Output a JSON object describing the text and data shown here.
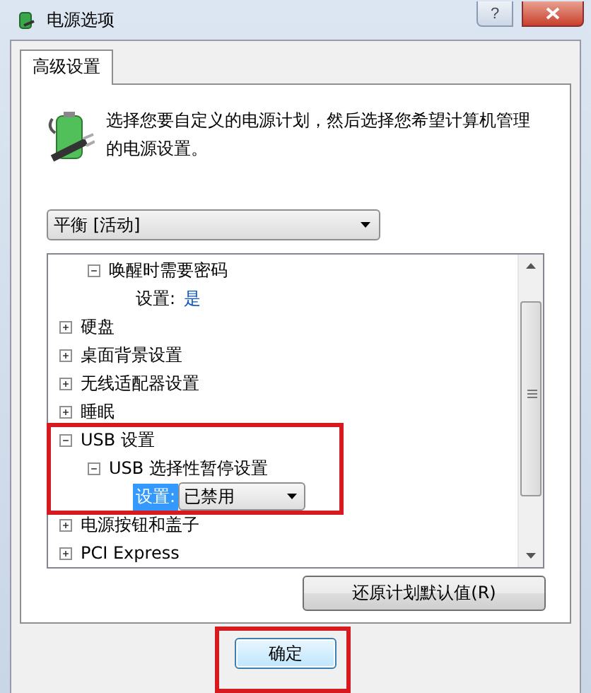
{
  "window": {
    "title": "电源选项",
    "help": "?"
  },
  "tabs": [
    {
      "label": "高级设置",
      "selected": true
    }
  ],
  "description": "选择您要自定义的电源计划，然后选择您希望计算机管理的电源设置。",
  "plan_dropdown": {
    "value": "平衡 [活动]"
  },
  "tree": {
    "items": [
      {
        "kind": "hidden-parent",
        "children": [
          {
            "kind": "group",
            "label": "唤醒时需要密码",
            "expanded": true,
            "children": [
              {
                "kind": "setting",
                "label": "设置:",
                "value": "是",
                "selected": false
              }
            ]
          }
        ]
      },
      {
        "kind": "group",
        "label": "硬盘",
        "expanded": false
      },
      {
        "kind": "group",
        "label": "桌面背景设置",
        "expanded": false
      },
      {
        "kind": "group",
        "label": "无线适配器设置",
        "expanded": false
      },
      {
        "kind": "group",
        "label": "睡眠",
        "expanded": false
      },
      {
        "kind": "group",
        "label": "USB 设置",
        "expanded": true,
        "children": [
          {
            "kind": "group",
            "label": "USB 选择性暂停设置",
            "expanded": true,
            "children": [
              {
                "kind": "dropdown-setting",
                "label": "设置:",
                "value": "已禁用",
                "selected": true
              }
            ]
          }
        ]
      },
      {
        "kind": "group",
        "label": "电源按钮和盖子",
        "expanded": false
      },
      {
        "kind": "group",
        "label": "PCI Express",
        "expanded": false
      }
    ]
  },
  "restore_button": "还原计划默认值(R)",
  "ok_button": "确定"
}
